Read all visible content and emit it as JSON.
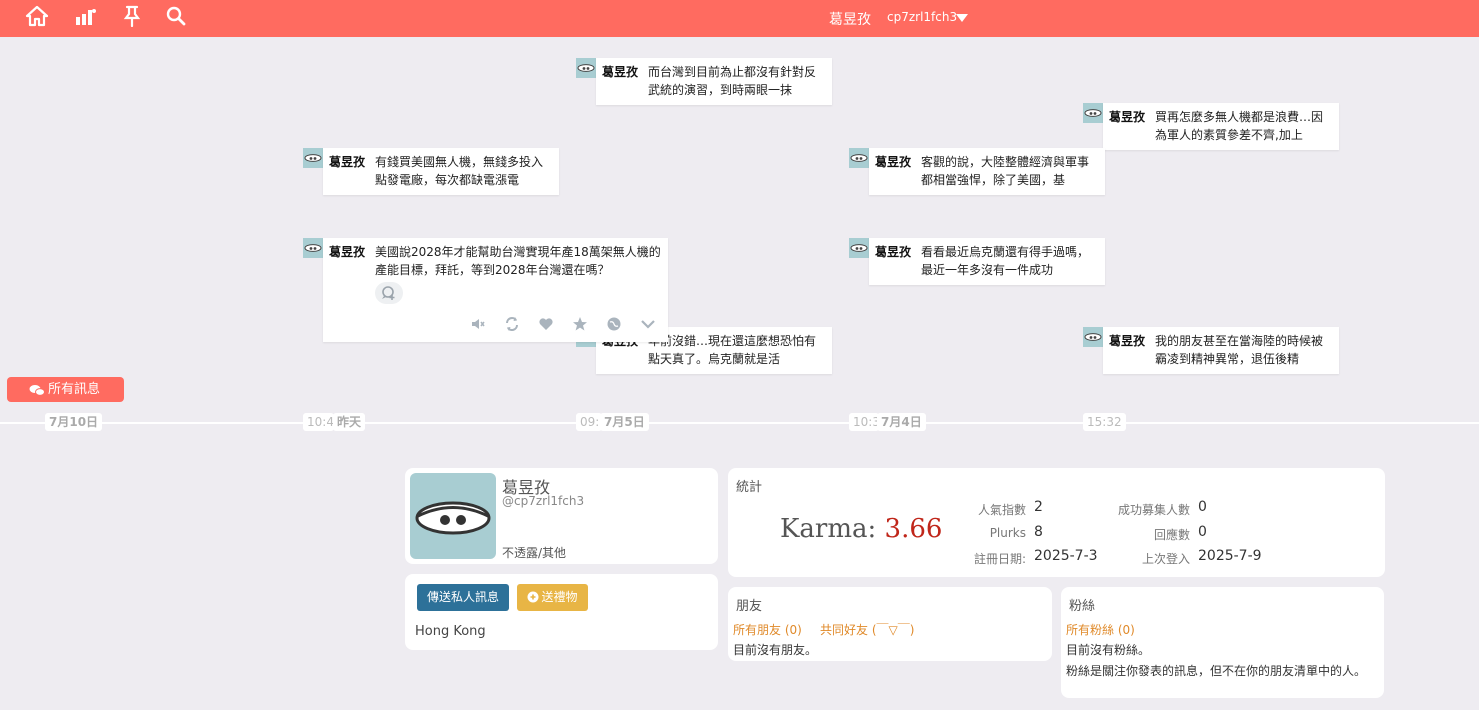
{
  "topbar": {
    "display_name": "葛昱孜",
    "user_id": "cp7zrl1fch3",
    "icons": [
      "home-icon",
      "stats-icon",
      "pin-icon",
      "search-icon",
      "caret-down-icon"
    ]
  },
  "timeline": {
    "plurks": [
      {
        "name": "葛昱孜",
        "text": "而台灣到目前為止都沒有針對反武統的演習，到時兩眼一抹"
      },
      {
        "name": "葛昱孜",
        "text": "買再怎麼多無人機都是浪費…因為軍人的素質參差不齊,加上"
      },
      {
        "name": "葛昱孜",
        "text": "有錢買美國無人機，無錢多投入點發電廠，每次都缺電漲電"
      },
      {
        "name": "葛昱孜",
        "text": "客觀的說，大陸整體經濟與軍事都相當強悍，除了美國，基"
      },
      {
        "name": "葛昱孜",
        "text": "美國說2028年才能幫助台灣實現年產18萬架無人機的產能目標，拜託，等到2028年台灣還在嗎？"
      },
      {
        "name": "葛昱孜",
        "text": "看看最近烏克蘭還有得手過嗎，最近一年多沒有一件成功"
      },
      {
        "name": "葛昱孜",
        "text": "年前沒錯…現在還這麼想恐怕有點天真了。烏克蘭就是活"
      },
      {
        "name": "葛昱孜",
        "text": "我的朋友甚至在當海陸的時候被霸凌到精神異常，退伍後精"
      }
    ],
    "all_plurks_label": "所有訊息",
    "ticks": [
      "7月10日",
      "10:4",
      "昨天",
      "09:",
      "7月5日",
      "10:3",
      "7月4日",
      "15:32"
    ]
  },
  "profile": {
    "display_name": "葛昱孜",
    "handle": "@cp7zrl1fch3",
    "gender": "不透露/其他",
    "send_message_label": "傳送私人訊息",
    "send_gift_label": "送禮物",
    "location": "Hong Kong"
  },
  "stats": {
    "title": "統計",
    "karma_label": "Karma:",
    "karma_value": "3.66",
    "popularity_label": "人氣指數",
    "popularity_value": "2",
    "recruit_label": "成功募集人數",
    "recruit_value": "0",
    "plurks_label": "Plurks",
    "plurks_value": "8",
    "responses_label": "回應數",
    "responses_value": "0",
    "registered_label": "註冊日期:",
    "registered_value": "2025-7-3",
    "last_login_label": "上次登入",
    "last_login_value": "2025-7-9"
  },
  "friends": {
    "title": "朋友",
    "all_friends": "所有朋友 (0)",
    "mutual_friends": "共同好友 (￣▽￣)",
    "empty_text": "目前沒有朋友。"
  },
  "fans": {
    "title": "粉絲",
    "all_fans": "所有粉絲 (0)",
    "empty_text": "目前沒有粉絲。",
    "description": "粉絲是關注你發表的訊息，但不在你的朋友清單中的人。"
  },
  "colors": {
    "brand": "#ff6b60",
    "karma": "#c0261a",
    "message_button": "#2d7199",
    "gift_button": "#e8b545",
    "link": "#e08a2a"
  }
}
